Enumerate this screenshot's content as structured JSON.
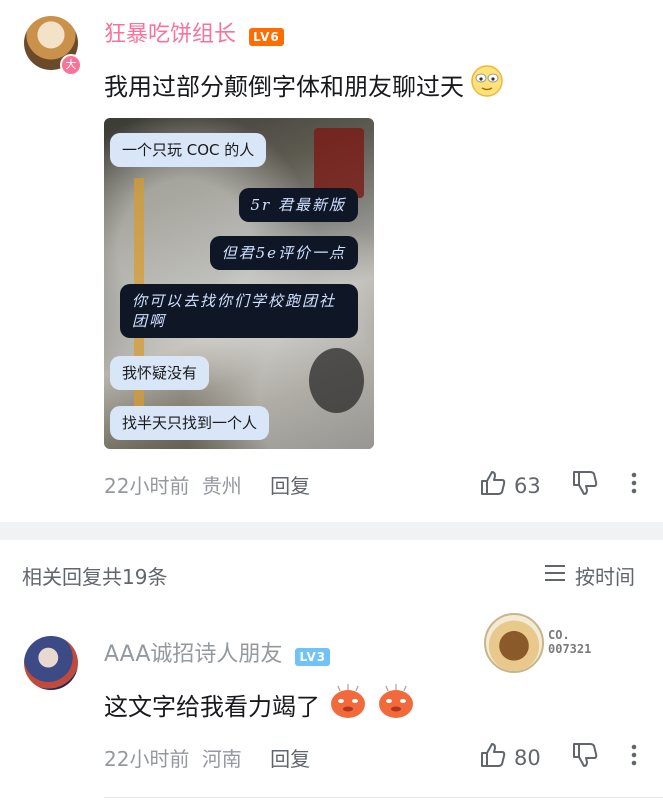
{
  "comment1": {
    "username": "狂暴吃饼组长",
    "level": "LV6",
    "text": "我用过部分颠倒字体和朋友聊过天",
    "emoji": "sleepy-face",
    "chat_image": {
      "bubbles": [
        "一个只玩 COC 的人",
        "5r 君最新版",
        "但君5e评价一点",
        "你可以去找你们学校跑团社团啊",
        "我怀疑没有",
        "找半天只找到一个人"
      ]
    },
    "time": "22小时前",
    "location": "贵州",
    "reply_label": "回复",
    "likes": "63"
  },
  "replies_header": {
    "count_label": "相关回复共19条",
    "sort_label": "按时间"
  },
  "comment2": {
    "username": "AAA诚招诗人朋友",
    "level": "LV3",
    "text": "这文字给我看力竭了",
    "decoration_label": "CO.\n007321",
    "time": "22小时前",
    "location": "河南",
    "reply_label": "回复",
    "likes": "80"
  },
  "colors": {
    "username_pink": "#fb7299",
    "lv6_orange": "#ff6c00",
    "lv3_blue": "#6fc3f5",
    "meta_gray": "#9499a0"
  }
}
